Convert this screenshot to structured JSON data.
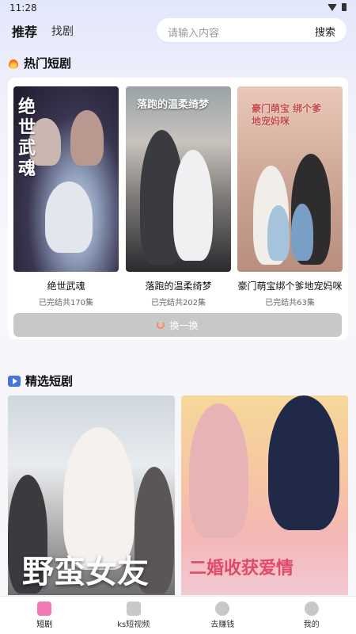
{
  "status": {
    "time": "11:28"
  },
  "header": {
    "tab_main": "推荐",
    "tab_sub": "找剧",
    "search_placeholder": "请输入内容",
    "search_button": "搜索"
  },
  "hot_section": {
    "title": "热门短剧",
    "items": [
      {
        "name": "绝世武魂",
        "meta": "已完结共170集",
        "poster_text": "绝世武魂"
      },
      {
        "name": "落跑的温柔绮梦",
        "meta": "已完结共202集",
        "poster_text": "落跑的温柔绮梦"
      },
      {
        "name": "豪门萌宝绑个爹地宠妈咪",
        "meta": "已完结共63集",
        "poster_text": "豪门萌宝 绑个爹地宠妈咪"
      }
    ],
    "refresh_label": "换一换"
  },
  "featured_section": {
    "title": "精选短剧",
    "items": [
      {
        "poster_text": "野蛮女友"
      },
      {
        "poster_text": "二婚收获爱情"
      }
    ]
  },
  "bottom_nav": [
    {
      "label": "短剧",
      "icon": "drama-icon",
      "color": "#f07bb3"
    },
    {
      "label": "ks短视频",
      "icon": "tv-icon",
      "color": "#c8c8c8"
    },
    {
      "label": "去赚钱",
      "icon": "coin-icon",
      "color": "#c8c8c8"
    },
    {
      "label": "我的",
      "icon": "user-icon",
      "color": "#c8c8c8"
    }
  ]
}
